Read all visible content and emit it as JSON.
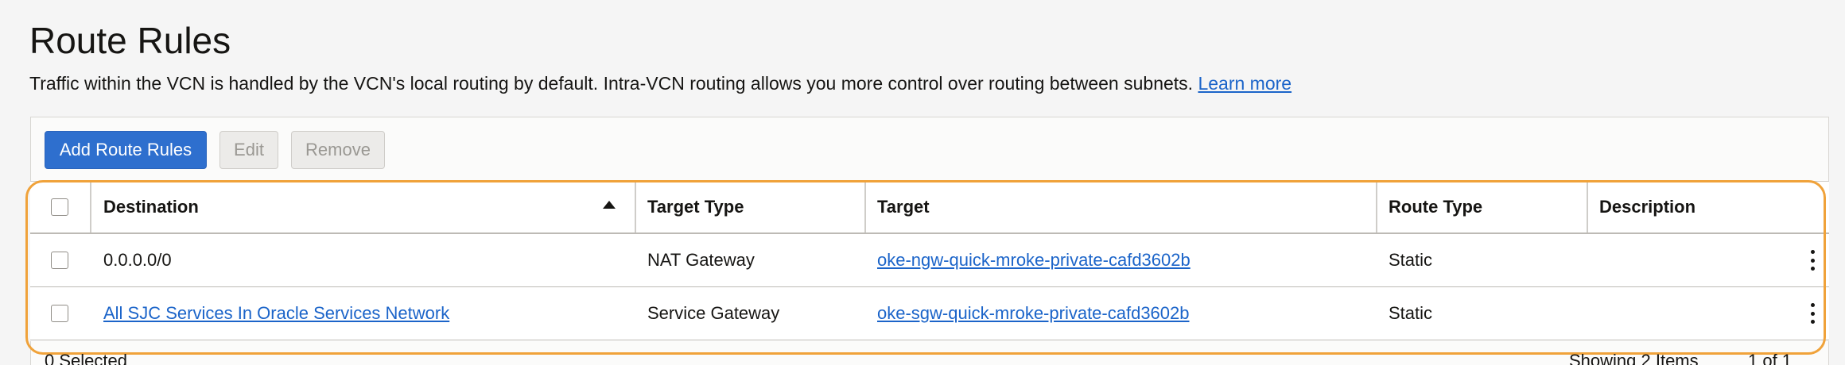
{
  "page": {
    "title": "Route Rules",
    "description": "Traffic within the VCN is handled by the VCN's local routing by default. Intra-VCN routing allows you more control over routing between subnets.",
    "learn_more": "Learn more"
  },
  "toolbar": {
    "add_label": "Add Route Rules",
    "edit_label": "Edit",
    "remove_label": "Remove"
  },
  "table": {
    "columns": [
      "Destination",
      "Target Type",
      "Target",
      "Route Type",
      "Description"
    ],
    "sort": {
      "column": "Destination",
      "direction": "ascending"
    },
    "rows": [
      {
        "destination": "0.0.0.0/0",
        "target_type": "NAT Gateway",
        "target": "oke-ngw-quick-mroke-private-cafd3602b",
        "route_type": "Static",
        "description": ""
      },
      {
        "destination": "All SJC Services In Oracle Services Network",
        "target_type": "Service Gateway",
        "target": "oke-sgw-quick-mroke-private-cafd3602b",
        "route_type": "Static",
        "description": ""
      }
    ]
  },
  "footer": {
    "selected": "0 Selected",
    "showing": "Showing 2 Items",
    "pagination": "1 of 1"
  },
  "colors": {
    "primary": "#2e6fce",
    "link": "#1b64c9",
    "highlight": "#f0a23a"
  }
}
